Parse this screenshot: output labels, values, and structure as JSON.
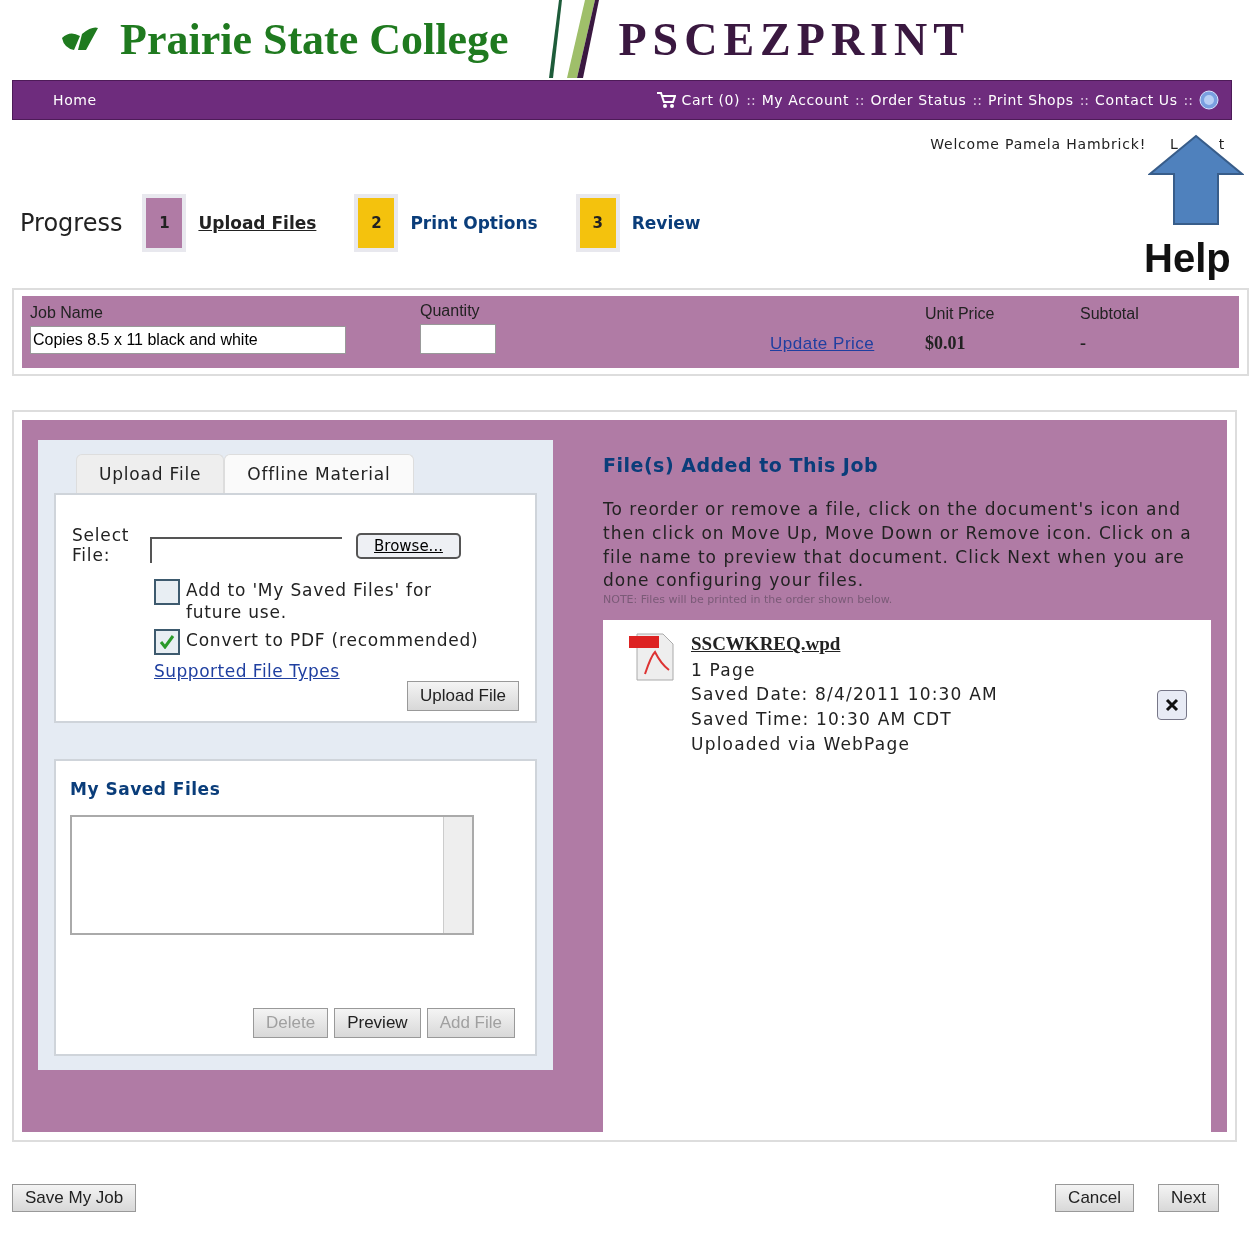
{
  "header": {
    "college": "Prairie State College",
    "product": "PSCEZPRINT"
  },
  "nav": {
    "home": "Home",
    "items": [
      {
        "kind": "link",
        "label": "Cart (0)"
      },
      {
        "kind": "separator",
        "label": "::"
      },
      {
        "kind": "link",
        "label": "My Account"
      },
      {
        "kind": "separator",
        "label": "::"
      },
      {
        "kind": "link",
        "label": "Order Status"
      },
      {
        "kind": "separator",
        "label": "::"
      },
      {
        "kind": "link",
        "label": "Print Shops"
      },
      {
        "kind": "separator",
        "label": "::"
      },
      {
        "kind": "link",
        "label": "Contact Us"
      },
      {
        "kind": "separator",
        "label": "::"
      }
    ]
  },
  "user": {
    "welcome": "Welcome Pamela Hambrick!",
    "logout_parts": [
      "L",
      "t"
    ]
  },
  "annotation": {
    "label": "Help"
  },
  "progress": {
    "title": "Progress",
    "steps": [
      {
        "number": "1",
        "label": "Upload Files",
        "selected": true
      },
      {
        "number": "2",
        "label": "Print Options",
        "selected": false
      },
      {
        "number": "3",
        "label": "Review",
        "selected": false
      }
    ]
  },
  "job": {
    "name_label": "Job Name",
    "name_value": "Copies 8.5 x 11 black and white",
    "quantity_label": "Quantity",
    "update_link": "Update Price",
    "unit_price_label": "Unit Price",
    "unit_price": "$0.01",
    "subtotal_label": "Subtotal",
    "subtotal": "-"
  },
  "upload": {
    "tabs": [
      {
        "label": "Upload File",
        "selected": true
      },
      {
        "label": "Offline Material",
        "selected": false
      }
    ],
    "select_label": "Select File:",
    "browse": "Browse...",
    "options": [
      {
        "label": "Add to 'My Saved Files' for future use.",
        "checked": false
      },
      {
        "label": "Convert to PDF (recommended)",
        "checked": true
      }
    ],
    "link": "Supported File Types",
    "upload_button": "Upload File"
  },
  "saved_files": {
    "title": "My Saved Files",
    "buttons": [
      {
        "label": "Delete",
        "disabled": true
      },
      {
        "label": "Preview",
        "disabled": false
      },
      {
        "label": "Add File",
        "disabled": true
      }
    ]
  },
  "files_panel": {
    "title": "File(s) Added to This Job",
    "instructions": "To reorder or remove a file, click on the document's icon and then click on Move Up, Move Down or Remove icon. Click on a file name to preview that document. Click Next when you are done configuring your files.",
    "note": "NOTE: Files will be printed in the order shown below.",
    "files": [
      {
        "name": "SSCWKREQ.wpd",
        "lines": [
          "1 Page",
          "Saved Date: 8/4/2011 10:30 AM",
          "Saved Time: 10:30 AM CDT",
          "Uploaded via WebPage"
        ]
      }
    ]
  },
  "footer": {
    "save": "Save My Job",
    "cancel": "Cancel",
    "next": "Next"
  }
}
